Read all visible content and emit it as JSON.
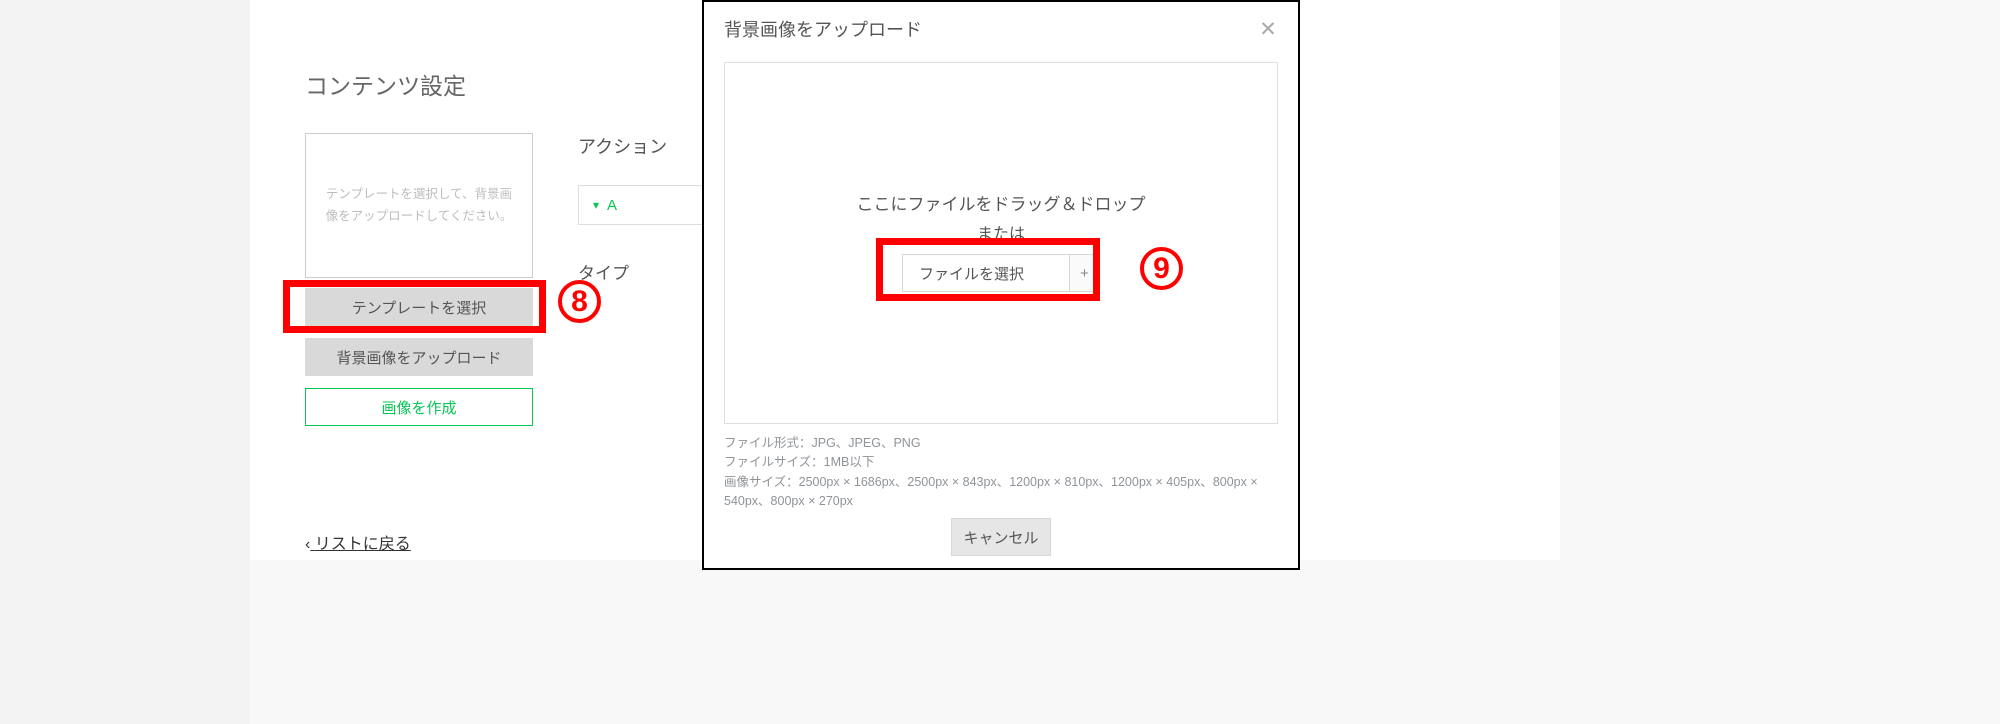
{
  "content": {
    "heading": "コンテンツ設定",
    "template_placeholder": "テンプレートを選択して、背景画像をアップロードしてください。",
    "btn_select_template": "テンプレートを選択",
    "btn_upload_bg": "背景画像をアップロード",
    "btn_create_image": "画像を作成",
    "action_heading": "アクション",
    "action_value": "A",
    "type_label": "タイプ"
  },
  "back_link": {
    "chevron": "‹",
    "text": "リストに戻る"
  },
  "modal": {
    "title": "背景画像をアップロード",
    "drag_text": "ここにファイルをドラッグ＆ドロップ",
    "or_text": "または",
    "file_select_label": "ファイルを選択",
    "plus": "+",
    "hint_format": "ファイル形式：JPG、JPEG、PNG",
    "hint_size": "ファイルサイズ：1MB以下",
    "hint_dims": "画像サイズ：2500px × 1686px、2500px × 843px、1200px × 810px、1200px × 405px、800px × 540px、800px × 270px",
    "cancel": "キャンセル"
  },
  "annotations": {
    "eight": "8",
    "nine": "9"
  }
}
